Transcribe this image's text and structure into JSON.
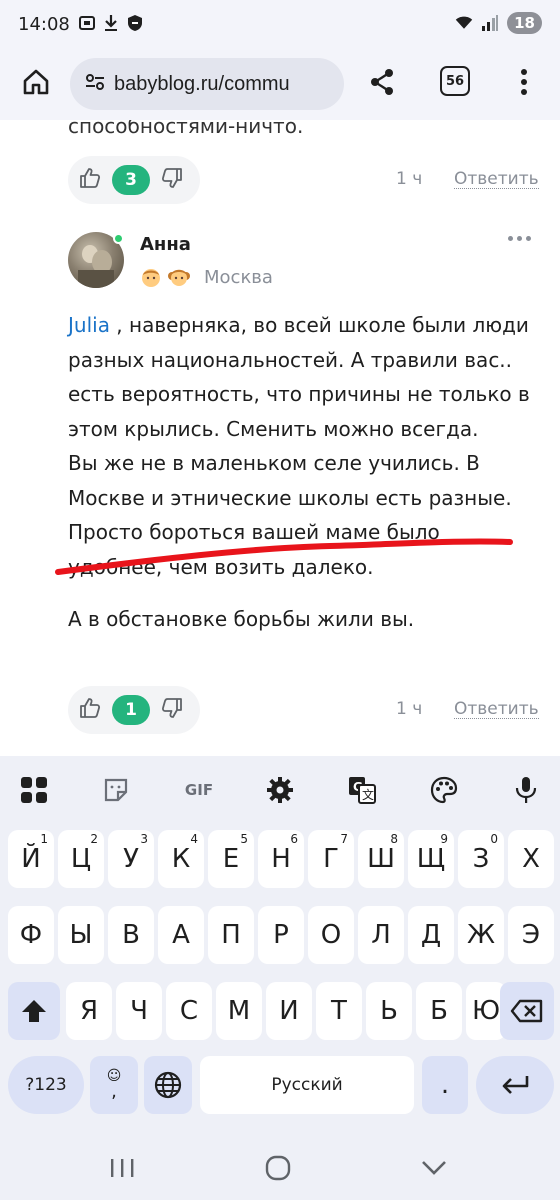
{
  "status_bar": {
    "time": "14:08",
    "battery": "18",
    "icons": [
      "screenshot-icon",
      "download-icon",
      "shield-icon",
      "wifi-icon",
      "signal-icon"
    ]
  },
  "browser": {
    "url": "babyblog.ru/commu",
    "tab_count": "56"
  },
  "previous_comment": {
    "cut_text": "способностями-ничто.",
    "likes": "3",
    "time": "1 ч",
    "reply": "Ответить"
  },
  "comment": {
    "author": "Анна",
    "city": "Москва",
    "mention": "Julia",
    "line1_rest": " , наверняка, во всей школе были люди разных национальностей. А травили вас.. есть вероятность, что причины не только в этом крылись. Сменить можно всегда.",
    "line2": "Вы же не в маленьком селе учились. В Москве и этнические школы есть разные. Просто бороться вашей маме было удобнее, чем возить далеко.",
    "line3": "А в обстановке борьбы жили вы.",
    "likes": "1",
    "time": "1 ч",
    "reply": "Ответить"
  },
  "keyboard": {
    "row1": [
      {
        "k": "Й",
        "h": "1"
      },
      {
        "k": "Ц",
        "h": "2"
      },
      {
        "k": "У",
        "h": "3"
      },
      {
        "k": "К",
        "h": "4"
      },
      {
        "k": "Е",
        "h": "5"
      },
      {
        "k": "Н",
        "h": "6"
      },
      {
        "k": "Г",
        "h": "7"
      },
      {
        "k": "Ш",
        "h": "8"
      },
      {
        "k": "Щ",
        "h": "9"
      },
      {
        "k": "З",
        "h": "0"
      },
      {
        "k": "Х",
        "h": ""
      }
    ],
    "row2": [
      "Ф",
      "Ы",
      "В",
      "А",
      "П",
      "Р",
      "О",
      "Л",
      "Д",
      "Ж",
      "Э"
    ],
    "row3": [
      "Я",
      "Ч",
      "С",
      "М",
      "И",
      "Т",
      "Ь",
      "Б",
      "Ю"
    ],
    "symbols_label": "?123",
    "space_label": "Русский",
    "period_label": ".",
    "comma_label": ",",
    "gif_label": "GIF"
  },
  "colors": {
    "accent_green": "#24b47e",
    "link_blue": "#1a73c8",
    "scribble_red": "#e8141b"
  }
}
